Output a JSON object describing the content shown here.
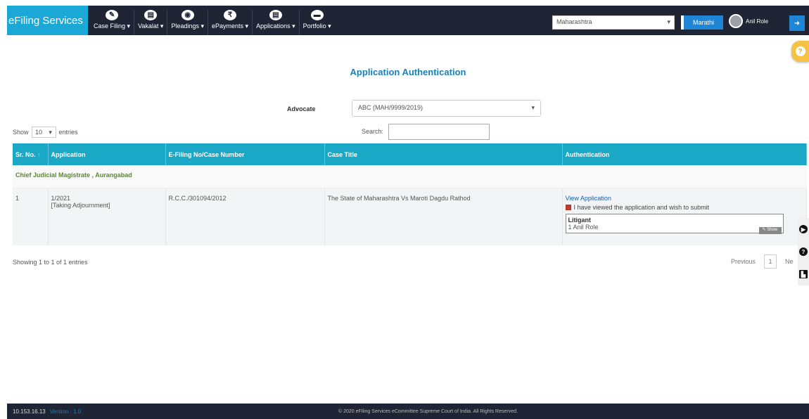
{
  "app": {
    "brand": "eFiling Services"
  },
  "nav": [
    {
      "label": "Case Filing",
      "icon": "pencil-icon",
      "glyph": "✎"
    },
    {
      "label": "Vakalat",
      "icon": "document-icon",
      "glyph": "▤"
    },
    {
      "label": "Pleadings",
      "icon": "eye-icon",
      "glyph": "◉"
    },
    {
      "label": "ePayments",
      "icon": "rupee-icon",
      "glyph": "₹"
    },
    {
      "label": "Applications",
      "icon": "file-icon",
      "glyph": "▤"
    },
    {
      "label": "Portfolio",
      "icon": "briefcase-icon",
      "glyph": "▬"
    }
  ],
  "header": {
    "state_select": "Maharashtra",
    "language_button": "Marathi",
    "user_name": "Anil Role"
  },
  "page": {
    "title": "Application Authentication",
    "advocate_label": "Advocate",
    "advocate_value": "ABC (MAH/9999/2019)"
  },
  "table_controls": {
    "show": "Show",
    "entries_value": "10",
    "entries": "entries",
    "search_label": "Search:"
  },
  "table": {
    "headers": [
      "Sr. No.",
      "Application",
      "E-Filing No/Case Number",
      "Case Title",
      "Authentication"
    ],
    "group_label": "Chief Judicial Magistrate , Aurangabad",
    "rows": [
      {
        "sr": "1",
        "application_no": "1/2021",
        "application_type": "[Taking Adjournment]",
        "case_number": "R.C.C./301094/2012",
        "case_title": "The State of Maharashtra Vs Maroti Dagdu Rathod",
        "view_link": "View Application",
        "consent_text": "I have viewed the application and wish to submit",
        "litigant_heading": "Litigant",
        "litigant_name": "1 Anil Role",
        "show_button": "Show"
      }
    ]
  },
  "pagination": {
    "info": "Showing 1 to 1 of 1 entries",
    "previous": "Previous",
    "current": "1",
    "next": "Ne"
  },
  "footer": {
    "ip": "10.153.16.13",
    "version": "Version : 1.0",
    "copyright": "© 2020 eFiling Services eCommittee Supreme Court of India. All Rights Reserved."
  },
  "colors": {
    "nav_bg": "#1f2535",
    "brand_bg": "#1ba8d6",
    "table_header": "#1ba8c6",
    "title": "#1a7fb8"
  }
}
